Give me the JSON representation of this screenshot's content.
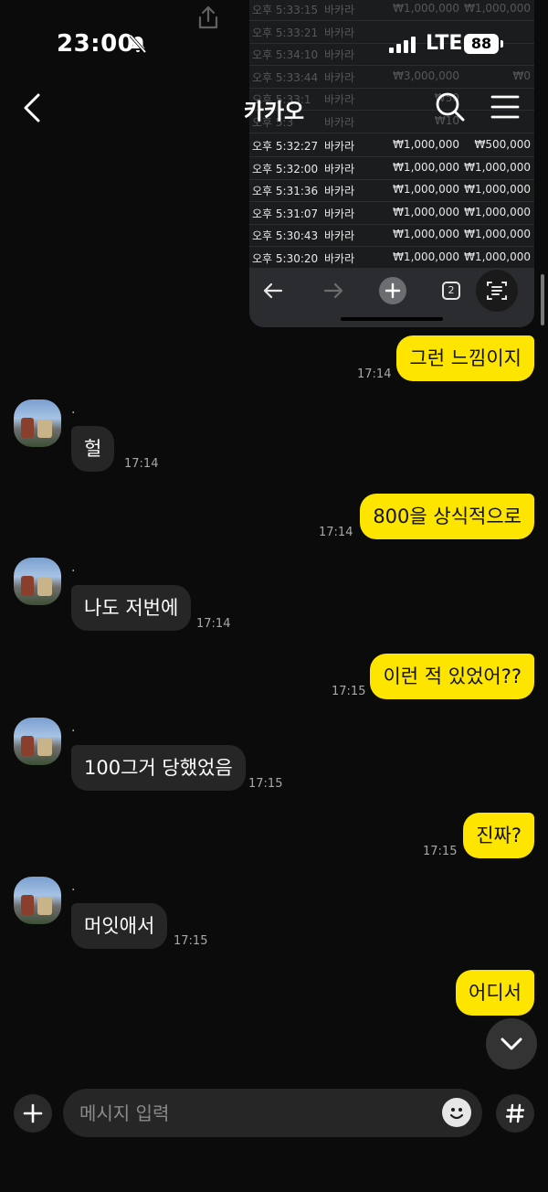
{
  "status_bar": {
    "time": "23:00",
    "network": "LTE",
    "battery": "88"
  },
  "header": {
    "title": "카카오"
  },
  "shared_screenshot": {
    "faded_rows": [
      [
        "오후 5:33:15",
        "바카라",
        "₩1,000,000",
        "₩1,000,000"
      ],
      [
        "오후 5:33:21",
        "바카라",
        "",
        ""
      ],
      [
        "오후 5:34:10",
        "바카라",
        "",
        ""
      ],
      [
        "오후 5:33:44",
        "바카라",
        "₩3,000,000",
        "₩0"
      ],
      [
        "오후 5:33:1",
        "바카라",
        "₩50",
        ""
      ],
      [
        "오후 5:3",
        "바카라",
        "₩10",
        ""
      ]
    ],
    "rows": [
      [
        "오후 5:32:27",
        "바카라",
        "₩1,000,000",
        "₩500,000"
      ],
      [
        "오후 5:32:00",
        "바카라",
        "₩1,000,000",
        "₩1,000,000"
      ],
      [
        "오후 5:31:36",
        "바카라",
        "₩1,000,000",
        "₩1,000,000"
      ],
      [
        "오후 5:31:07",
        "바카라",
        "₩1,000,000",
        "₩1,000,000"
      ],
      [
        "오후 5:30:43",
        "바카라",
        "₩1,000,000",
        "₩1,000,000"
      ],
      [
        "오후 5:30:20",
        "바카라",
        "₩1,000,000",
        "₩1,000,000"
      ]
    ],
    "tab_count": "2"
  },
  "messages": [
    {
      "dir": "out",
      "text": "그런 느낌이지",
      "time": "17:14"
    },
    {
      "dir": "in",
      "sender": ".",
      "text": "헐",
      "time": "17:14"
    },
    {
      "dir": "out",
      "text": "800을 상식적으로",
      "time": "17:14"
    },
    {
      "dir": "in",
      "sender": ".",
      "text": "나도 저번에",
      "time": "17:14"
    },
    {
      "dir": "out",
      "text": "이런 적 있었어??",
      "time": "17:15"
    },
    {
      "dir": "in",
      "sender": ".",
      "text": "100그거 당했었음",
      "time": "17:15"
    },
    {
      "dir": "out",
      "text": "진짜?",
      "time": "17:15"
    },
    {
      "dir": "in",
      "sender": ".",
      "text": "머잇애서",
      "time": "17:15"
    },
    {
      "dir": "out",
      "text": "어디서",
      "time": ""
    }
  ],
  "input": {
    "placeholder": "메시지 입력"
  },
  "colors": {
    "bubble_out": "#fee500",
    "bubble_in": "#262626",
    "background": "#0b0b0b"
  }
}
